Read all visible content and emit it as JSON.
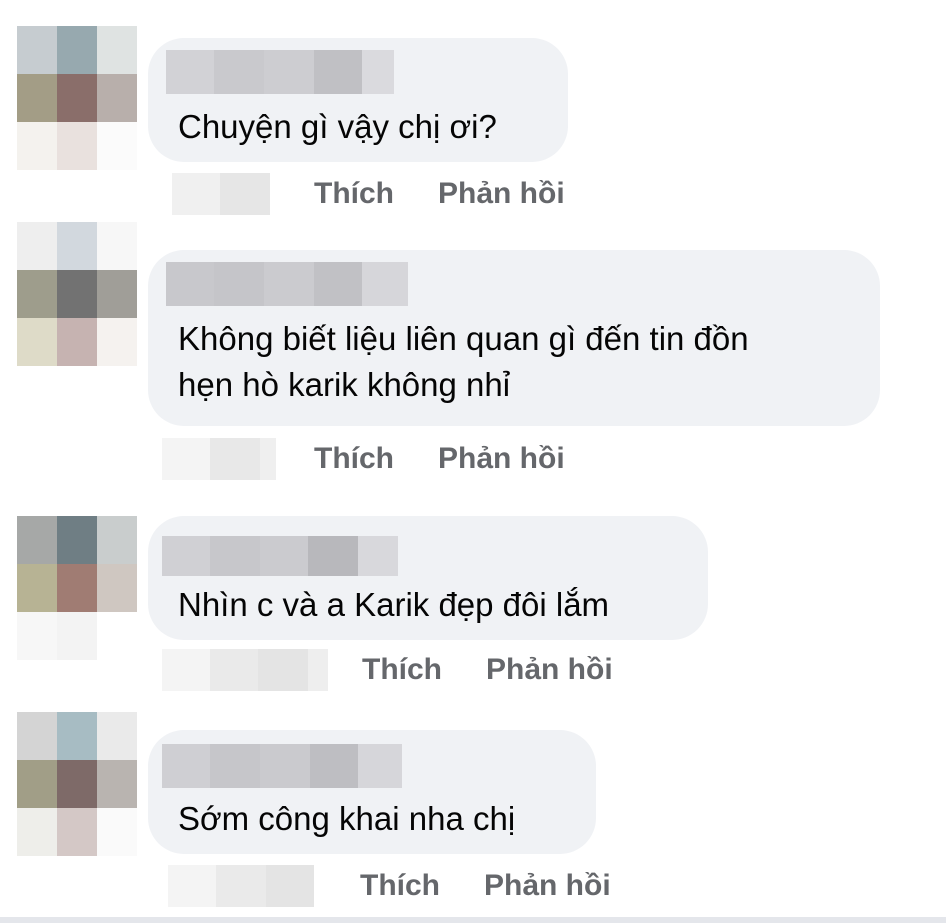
{
  "comments": [
    {
      "text_lines": [
        "Chuyện gì vậy chị ơi?"
      ],
      "like_label": "Thích",
      "reply_label": "Phản hồi"
    },
    {
      "text_lines": [
        "Không biết liệu liên quan gì đến tin đồn",
        "hẹn hò karik không nhỉ"
      ],
      "like_label": "Thích",
      "reply_label": "Phản hồi"
    },
    {
      "text_lines": [
        "Nhìn c và a Karik đẹp đôi lắm"
      ],
      "like_label": "Thích",
      "reply_label": "Phản hồi"
    },
    {
      "text_lines": [
        "Sớm công khai nha chị"
      ],
      "like_label": "Thích",
      "reply_label": "Phản hồi"
    }
  ],
  "colors": {
    "bubble_bg": "#f0f2f5",
    "text": "#050505",
    "action_text": "#65676b",
    "background": "#ffffff"
  },
  "icons": {
    "avatar": "pixelated-avatar-icon",
    "name": "blurred-name",
    "timestamp": "blurred-timestamp"
  }
}
